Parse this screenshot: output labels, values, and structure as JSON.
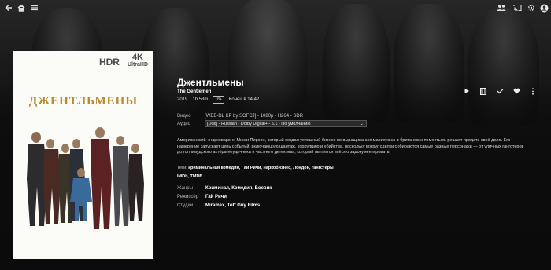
{
  "topbar": {
    "back_icon": "arrow-left-icon",
    "home_icon": "home-icon",
    "menu_icon": "hamburger-menu-icon",
    "right_icons": [
      "users-icon",
      "cast-icon",
      "settings-gear-icon",
      "search-icon"
    ]
  },
  "poster": {
    "hdr": "HDR",
    "uhd_main": "4K",
    "uhd_sub": "UltraHD",
    "title": "ДЖЕНТЛЬМЕНЫ"
  },
  "movie": {
    "title": "Джентльмены",
    "original_title": "The Gentlemen",
    "year": "2019",
    "runtime": "1h 53m",
    "rating": "18+",
    "ends_at": "Конец в 14:42"
  },
  "actions": [
    "play-icon",
    "trailer-icon",
    "watched-check-icon",
    "favorite-heart-icon",
    "more-vertical-icon"
  ],
  "media": {
    "video_label": "Видео",
    "video_value": "[WEB-DL KP by SOFCJ] - 1080p - H264 - SDR",
    "audio_label": "Аудио",
    "audio_value": "[Dub] - Russian - Dolby Digital+ - 5.1 - По умолчанию"
  },
  "overview": "Американский «нарковарон» Микки Пирсон, который создал успешный бизнес по выращиванию марихуаны в британских поместьях, решает продать своё дело. Его намерение запускает цепь событий, включающую шантаж, коррупцию и убийства, поскольку вокруг сделки собираются самые разные персонажи — от уличных гангстеров до голливудского актёра-неудачника и частного детектива, который пытается всё это задокументировать.",
  "tags": {
    "label": "Теги:",
    "values": "криминальная комедия, Гай Ричи, наркобизнес, Лондон, гангстеры"
  },
  "links": "IMDb, TMDB",
  "details": [
    {
      "label": "Жанры",
      "value": "Криминал, Комедия, Боевик"
    },
    {
      "label": "Режиссёр",
      "value": "Гай Ричи"
    },
    {
      "label": "Студии",
      "value": "Miramax, Toff Guy Films"
    }
  ]
}
